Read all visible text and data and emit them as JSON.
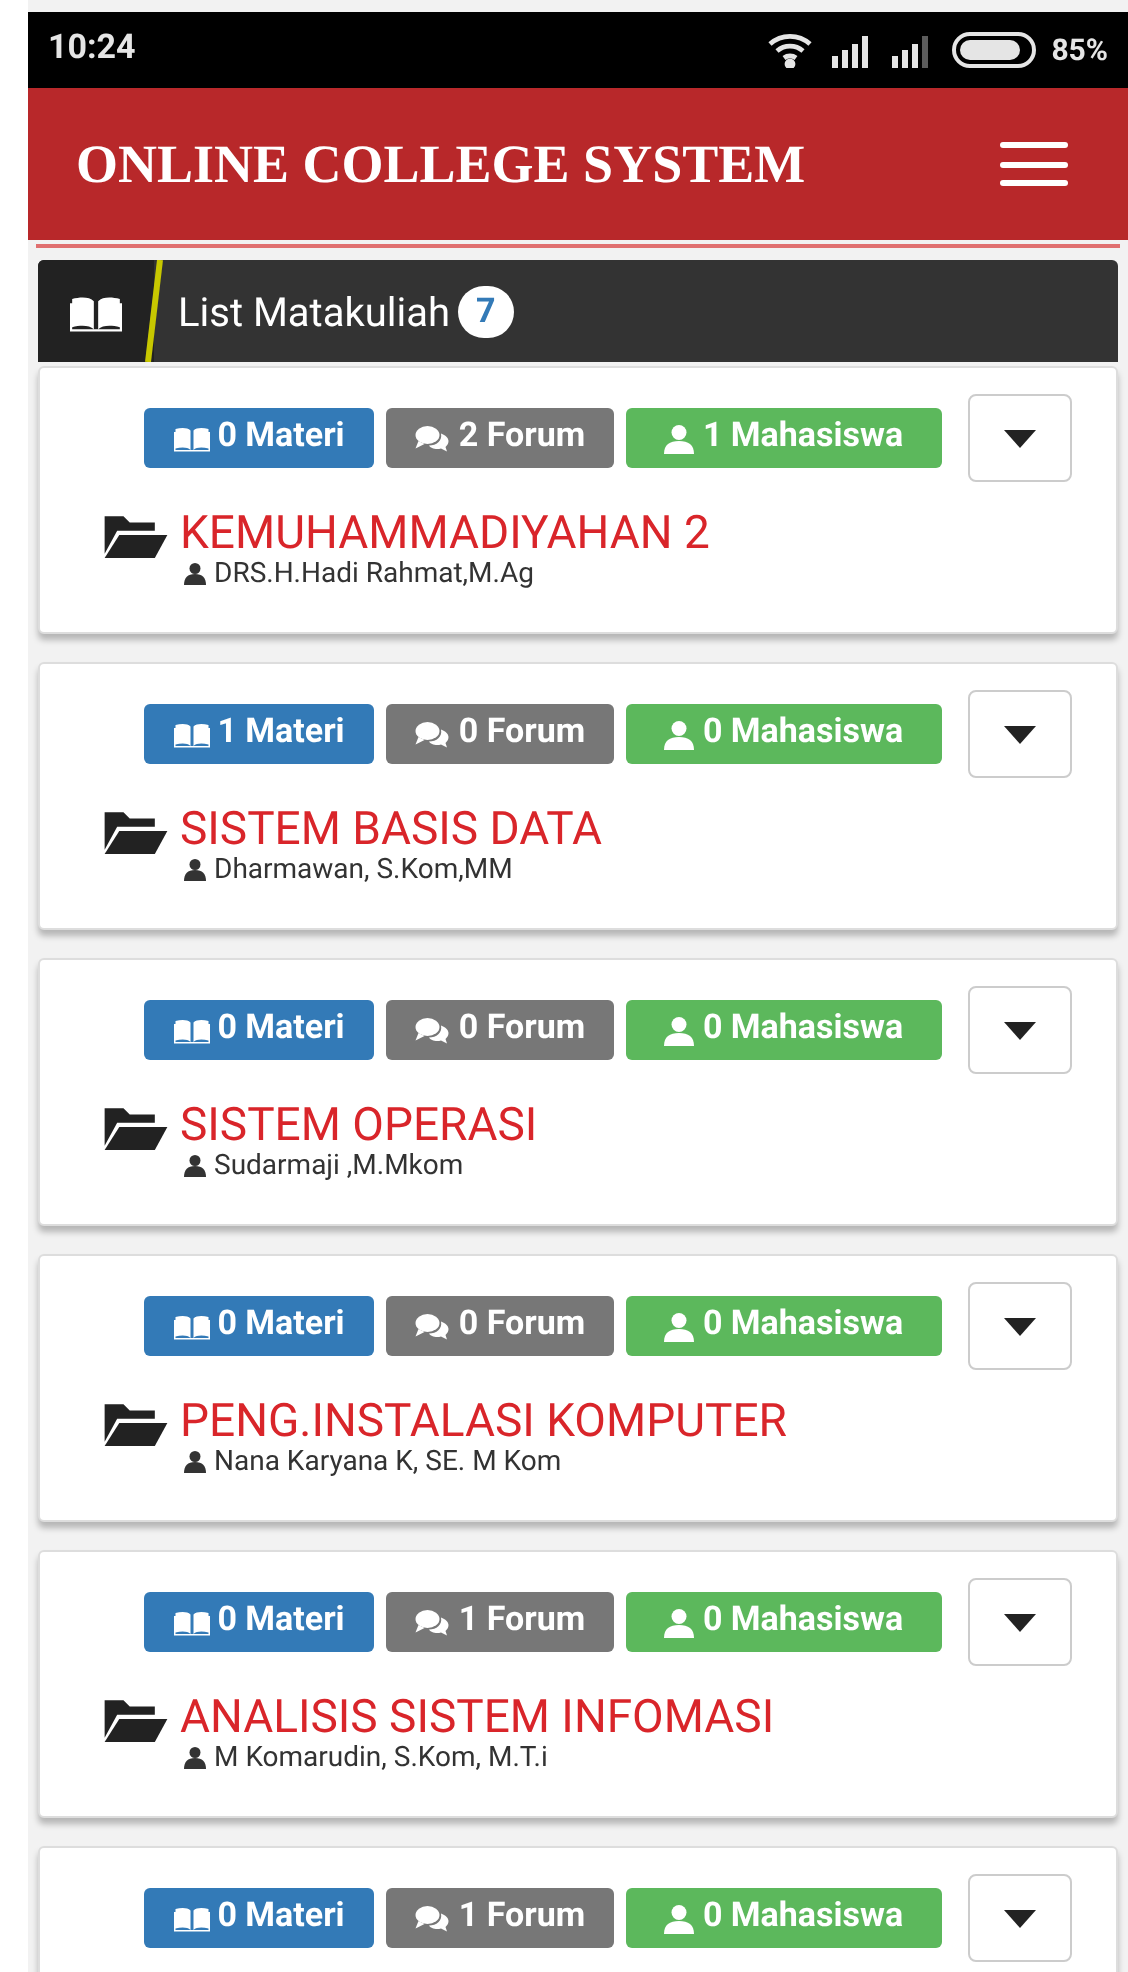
{
  "status_bar": {
    "time": "10:24",
    "battery": "85%"
  },
  "navbar": {
    "title": "ONLINE COLLEGE SYSTEM"
  },
  "panel": {
    "title": "List Matakuliah",
    "count": "7"
  },
  "courses": [
    {
      "materi": "0 Materi",
      "forum": "2 Forum",
      "mahasiswa": "1 Mahasiswa",
      "name": "KEMUHAMMADIYAHAN 2",
      "lecturer": "DRS.H.Hadi Rahmat,M.Ag"
    },
    {
      "materi": "1 Materi",
      "forum": "0 Forum",
      "mahasiswa": "0 Mahasiswa",
      "name": "SISTEM BASIS DATA",
      "lecturer": "Dharmawan, S.Kom,MM"
    },
    {
      "materi": "0 Materi",
      "forum": "0 Forum",
      "mahasiswa": "0 Mahasiswa",
      "name": "SISTEM OPERASI",
      "lecturer": "Sudarmaji ,M.Mkom"
    },
    {
      "materi": "0 Materi",
      "forum": "0 Forum",
      "mahasiswa": "0 Mahasiswa",
      "name": "PENG.INSTALASI KOMPUTER",
      "lecturer": "Nana Karyana K, SE. M Kom"
    },
    {
      "materi": "0 Materi",
      "forum": "1 Forum",
      "mahasiswa": "0 Mahasiswa",
      "name": "ANALISIS SISTEM INFOMASI",
      "lecturer": "M Komarudin, S.Kom, M.T.i"
    },
    {
      "materi": "0 Materi",
      "forum": "1 Forum",
      "mahasiswa": "0 Mahasiswa"
    }
  ]
}
